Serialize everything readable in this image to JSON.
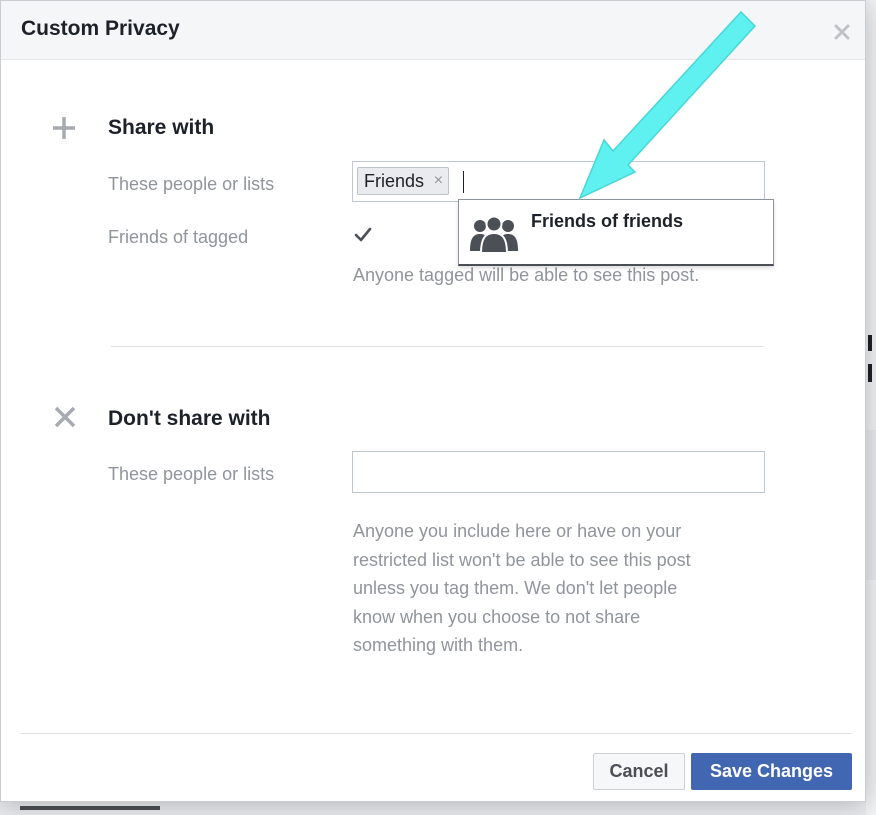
{
  "dialog": {
    "title": "Custom Privacy",
    "close_icon": "close-icon"
  },
  "share_with": {
    "title": "Share with",
    "icon": "plus-icon",
    "people_label": "These people or lists",
    "tokens": [
      {
        "label": "Friends",
        "remove_glyph": "×"
      }
    ],
    "suggestion": {
      "label": "Friends of friends",
      "icon": "group-icon"
    },
    "friends_of_tagged_label": "Friends of tagged",
    "friends_of_tagged_checked": true,
    "tagged_help": "Anyone tagged will be able to see this post."
  },
  "dont_share_with": {
    "title": "Don't share with",
    "icon": "x-icon",
    "people_label": "These people or lists",
    "input_value": "",
    "help_lines": [
      "Anyone you include here or have on your",
      "restricted list won't be able to see this post",
      "unless you tag them. We don't let people",
      "know when you choose to not share",
      "something with them."
    ]
  },
  "footer": {
    "cancel_label": "Cancel",
    "save_label": "Save Changes"
  },
  "colors": {
    "accent_blue": "#4267b2",
    "arrow_cyan": "#5ff0f0",
    "muted_text": "#90949c"
  }
}
